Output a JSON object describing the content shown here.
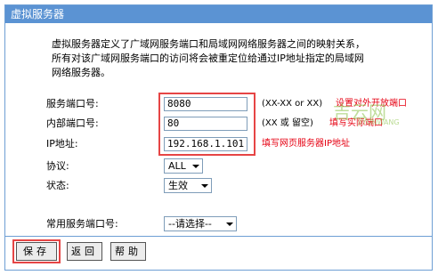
{
  "window": {
    "title": "虚拟服务器"
  },
  "description": {
    "line1": "虚拟服务器定义了广域网服务端口和局域网网络服务器之间的映射关系，",
    "line2": "所有对该广域网服务端口的访问将会被重定位给通过IP地址指定的局域网",
    "line3": "网络服务器。"
  },
  "form": {
    "service_port": {
      "label": "服务端口号:",
      "value": "8080",
      "hint": "(XX-XX or XX)",
      "annotation": "设置对外开放端口"
    },
    "internal_port": {
      "label": "内部端口号:",
      "value": "80",
      "hint": "(XX 或 留空)",
      "annotation": "填写实际端口"
    },
    "ip_address": {
      "label": "IP地址:",
      "value": "192.168.1.101",
      "annotation": "填写网页服务器IP地址"
    },
    "protocol": {
      "label": "协议:",
      "selected": "ALL"
    },
    "status": {
      "label": "状态:",
      "selected": "生效"
    },
    "common_port": {
      "label": "常用服务端口号:",
      "selected": "--请选择--"
    }
  },
  "buttons": {
    "save": "保存",
    "back": "返回",
    "help": "帮助"
  },
  "watermark": {
    "main": "吉云网",
    "sub": "JIYUNWANG"
  },
  "colors": {
    "titlebar": "#5b93d3",
    "annotation": "#e60012",
    "highlight": "#e64545"
  }
}
